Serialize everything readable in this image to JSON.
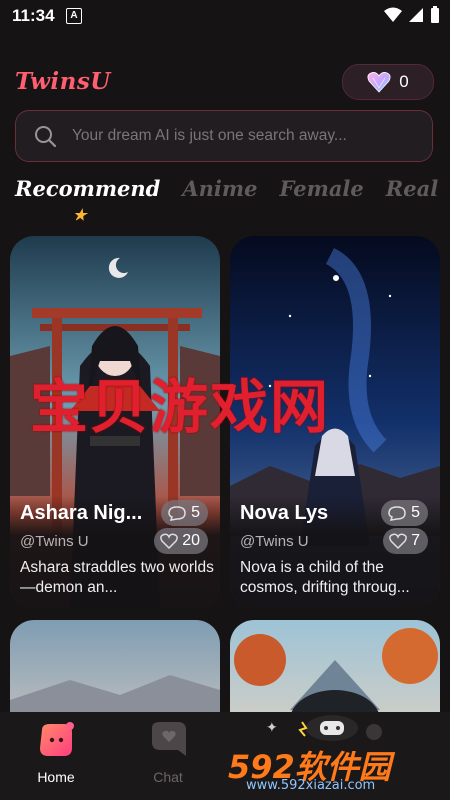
{
  "status_bar": {
    "time": "11:34",
    "notification_icon": "A"
  },
  "header": {
    "logo": "TwinsU",
    "coin_count": "0"
  },
  "search": {
    "placeholder": "Your dream AI is just one search away..."
  },
  "tabs": [
    {
      "label": "Recommend",
      "active": true
    },
    {
      "label": "Anime"
    },
    {
      "label": "Female"
    },
    {
      "label": "Real"
    }
  ],
  "cards": [
    {
      "name": "Ashara Nig...",
      "author": "@Twins U",
      "views": "5",
      "likes": "20",
      "description": "Ashara straddles two worlds—demon an..."
    },
    {
      "name": "Nova Lys",
      "author": "@Twins U",
      "views": "5",
      "likes": "7",
      "description": "Nova is a child of the cosmos, drifting throug..."
    }
  ],
  "nav": {
    "home_label": "Home",
    "chat_label": "Chat"
  },
  "overlay": {
    "center_text": "宝贝游戏网",
    "watermark_main": "592软件园",
    "watermark_url": "www.592xiazai.com"
  },
  "colors": {
    "brand": "#ff5f71",
    "background": "#151314",
    "star": "#ffb62e"
  }
}
